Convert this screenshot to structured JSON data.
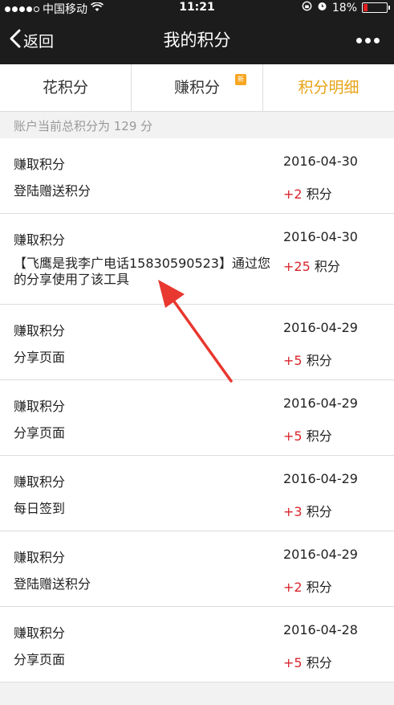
{
  "status": {
    "carrier": "中国移动",
    "time": "11:21",
    "battery": "18%",
    "battery_level": 0.18
  },
  "nav": {
    "back_label": "返回",
    "title": "我的积分"
  },
  "tabs": [
    {
      "label": "花积分"
    },
    {
      "label": "赚积分",
      "badge": "新"
    },
    {
      "label": "积分明细"
    }
  ],
  "summary": "账户当前总积分为 129 分",
  "points_unit": "积分",
  "records": [
    {
      "type": "赚取积分",
      "date": "2016-04-30",
      "desc": "登陆赠送积分",
      "amount": "+2"
    },
    {
      "type": "赚取积分",
      "date": "2016-04-30",
      "desc": "【飞鹰是我李广电话15830590523】通过您的分享使用了该工具",
      "amount": "+25"
    },
    {
      "type": "赚取积分",
      "date": "2016-04-29",
      "desc": "分享页面",
      "amount": "+5"
    },
    {
      "type": "赚取积分",
      "date": "2016-04-29",
      "desc": "分享页面",
      "amount": "+5"
    },
    {
      "type": "赚取积分",
      "date": "2016-04-29",
      "desc": "每日签到",
      "amount": "+3"
    },
    {
      "type": "赚取积分",
      "date": "2016-04-29",
      "desc": "登陆赠送积分",
      "amount": "+2"
    },
    {
      "type": "赚取积分",
      "date": "2016-04-28",
      "desc": "分享页面",
      "amount": "+5"
    }
  ],
  "colors": {
    "nav_bg": "#1c1c1c",
    "accent": "#e8a317",
    "points_red": "#d9262c",
    "annotation_red": "#e8382f"
  }
}
